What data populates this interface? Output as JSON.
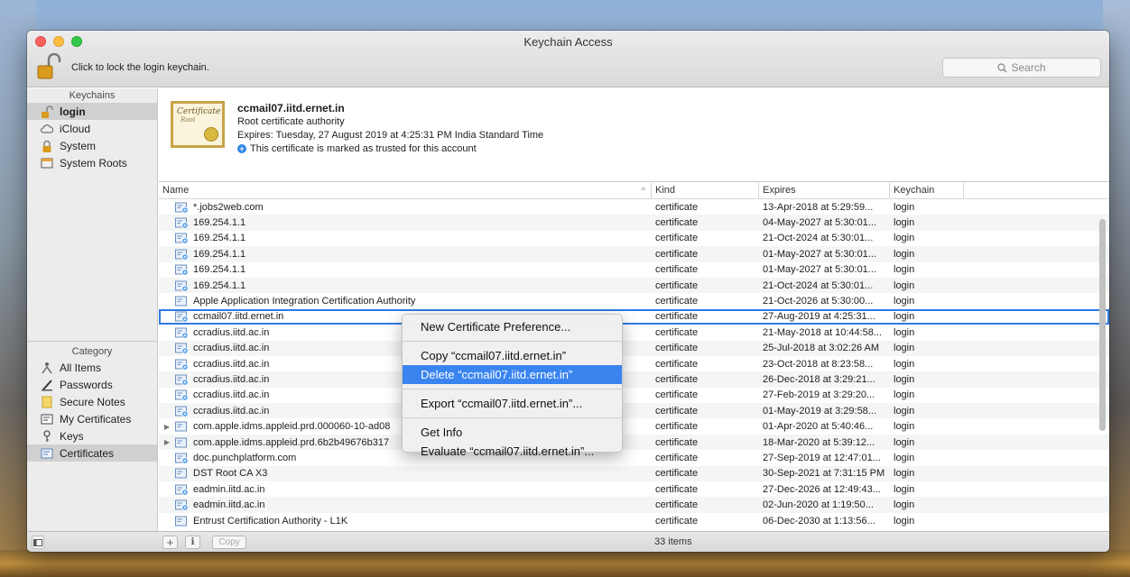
{
  "window": {
    "title": "Keychain Access"
  },
  "toolbar": {
    "lock_label": "Click to lock the login keychain.",
    "search_placeholder": "Search"
  },
  "sidebar": {
    "keychains_header": "Keychains",
    "keychains": [
      {
        "label": "login",
        "icon": "unlocked-padlock-icon",
        "selected": true
      },
      {
        "label": "iCloud",
        "icon": "cloud-icon"
      },
      {
        "label": "System",
        "icon": "padlock-icon"
      },
      {
        "label": "System Roots",
        "icon": "folder-icon"
      }
    ],
    "category_header": "Category",
    "categories": [
      {
        "label": "All Items",
        "icon": "all-items-icon"
      },
      {
        "label": "Passwords",
        "icon": "pencil-icon"
      },
      {
        "label": "Secure Notes",
        "icon": "note-icon"
      },
      {
        "label": "My Certificates",
        "icon": "certificate-icon"
      },
      {
        "label": "Keys",
        "icon": "key-icon"
      },
      {
        "label": "Certificates",
        "icon": "certificate-icon",
        "selected": true
      }
    ]
  },
  "detail": {
    "name": "ccmail07.iitd.ernet.in",
    "subtitle": "Root certificate authority",
    "expires": "Expires: Tuesday, 27 August 2019 at 4:25:31 PM India Standard Time",
    "trust": "This certificate is marked as trusted for this account",
    "image_text": {
      "title": "Certificate",
      "subtitle": "Root"
    }
  },
  "table": {
    "columns": {
      "name": "Name",
      "kind": "Kind",
      "expires": "Expires",
      "keychain": "Keychain"
    },
    "rows": [
      {
        "name": "*.jobs2web.com",
        "kind": "certificate",
        "expires": "13-Apr-2018 at 5:29:59...",
        "keychain": "login",
        "icon": "cert-blue"
      },
      {
        "name": "169.254.1.1",
        "kind": "certificate",
        "expires": "04-May-2027 at 5:30:01...",
        "keychain": "login",
        "icon": "cert-blue"
      },
      {
        "name": "169.254.1.1",
        "kind": "certificate",
        "expires": "21-Oct-2024 at 5:30:01...",
        "keychain": "login",
        "icon": "cert-blue"
      },
      {
        "name": "169.254.1.1",
        "kind": "certificate",
        "expires": "01-May-2027 at 5:30:01...",
        "keychain": "login",
        "icon": "cert-blue"
      },
      {
        "name": "169.254.1.1",
        "kind": "certificate",
        "expires": "01-May-2027 at 5:30:01...",
        "keychain": "login",
        "icon": "cert-blue"
      },
      {
        "name": "169.254.1.1",
        "kind": "certificate",
        "expires": "21-Oct-2024 at 5:30:01...",
        "keychain": "login",
        "icon": "cert-blue"
      },
      {
        "name": "Apple Application Integration Certification Authority",
        "kind": "certificate",
        "expires": "21-Oct-2026 at 5:30:00...",
        "keychain": "login",
        "icon": "cert-plain"
      },
      {
        "name": "ccmail07.iitd.ernet.in",
        "kind": "certificate",
        "expires": "27-Aug-2019 at 4:25:31...",
        "keychain": "login",
        "icon": "cert-blue",
        "selected": true
      },
      {
        "name": "ccradius.iitd.ac.in",
        "kind": "certificate",
        "expires": "21-May-2018 at 10:44:58...",
        "keychain": "login",
        "icon": "cert-blue"
      },
      {
        "name": "ccradius.iitd.ac.in",
        "kind": "certificate",
        "expires": "25-Jul-2018 at 3:02:26 AM",
        "keychain": "login",
        "icon": "cert-blue"
      },
      {
        "name": "ccradius.iitd.ac.in",
        "kind": "certificate",
        "expires": "23-Oct-2018 at 8:23:58...",
        "keychain": "login",
        "icon": "cert-blue"
      },
      {
        "name": "ccradius.iitd.ac.in",
        "kind": "certificate",
        "expires": "26-Dec-2018 at 3:29:21...",
        "keychain": "login",
        "icon": "cert-blue"
      },
      {
        "name": "ccradius.iitd.ac.in",
        "kind": "certificate",
        "expires": "27-Feb-2019 at 3:29:20...",
        "keychain": "login",
        "icon": "cert-blue"
      },
      {
        "name": "ccradius.iitd.ac.in",
        "kind": "certificate",
        "expires": "01-May-2019 at 3:29:58...",
        "keychain": "login",
        "icon": "cert-blue"
      },
      {
        "name": "com.apple.idms.appleid.prd.000060-10-ad08",
        "kind": "certificate",
        "expires": "01-Apr-2020 at 5:40:46...",
        "keychain": "login",
        "icon": "cert-plain",
        "disclosure": true
      },
      {
        "name": "com.apple.idms.appleid.prd.6b2b49676b317",
        "kind": "certificate",
        "expires": "18-Mar-2020 at 5:39:12...",
        "keychain": "login",
        "icon": "cert-plain",
        "disclosure": true
      },
      {
        "name": "doc.punchplatform.com",
        "kind": "certificate",
        "expires": "27-Sep-2019 at 12:47:01...",
        "keychain": "login",
        "icon": "cert-blue"
      },
      {
        "name": "DST Root CA X3",
        "kind": "certificate",
        "expires": "30-Sep-2021 at 7:31:15 PM",
        "keychain": "login",
        "icon": "cert-plain"
      },
      {
        "name": "eadmin.iitd.ac.in",
        "kind": "certificate",
        "expires": "27-Dec-2026 at 12:49:43...",
        "keychain": "login",
        "icon": "cert-blue"
      },
      {
        "name": "eadmin.iitd.ac.in",
        "kind": "certificate",
        "expires": "02-Jun-2020 at 1:19:50...",
        "keychain": "login",
        "icon": "cert-blue"
      },
      {
        "name": "Entrust Certification Authority - L1K",
        "kind": "certificate",
        "expires": "06-Dec-2030 at 1:13:56...",
        "keychain": "login",
        "icon": "cert-plain"
      }
    ]
  },
  "bottombar": {
    "copy_label": "Copy",
    "add_label": "+",
    "info_label": "i",
    "count": "33 items"
  },
  "context_menu": {
    "groups": [
      [
        "New Certificate Preference..."
      ],
      [
        "Copy “ccmail07.iitd.ernet.in”",
        "Delete “ccmail07.iitd.ernet.in”"
      ],
      [
        "Export “ccmail07.iitd.ernet.in”..."
      ],
      [
        "Get Info",
        "Evaluate “ccmail07.iitd.ernet.in”..."
      ]
    ],
    "highlighted": "Delete “ccmail07.iitd.ernet.in”"
  },
  "colors": {
    "accent": "#3a84f0",
    "selection_outline": "#2f7ae5",
    "cert_blue": "#4a9be8"
  }
}
